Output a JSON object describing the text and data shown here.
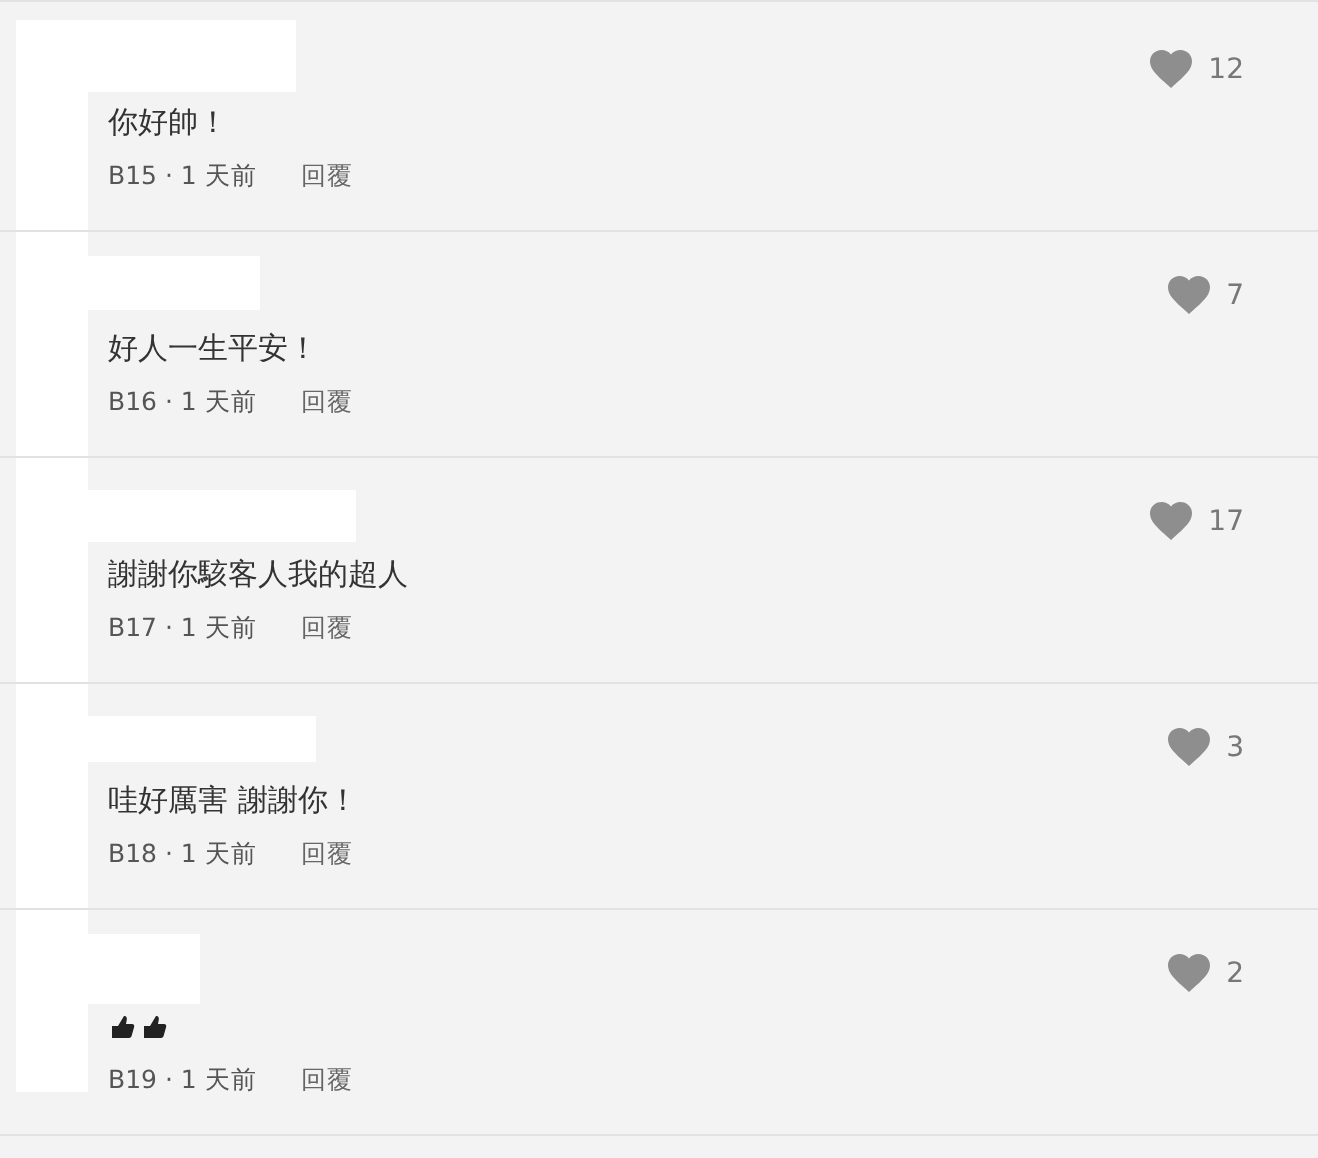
{
  "comments": [
    {
      "text": "你好帥！",
      "meta": "B15 · 1 天前",
      "reply": "回覆",
      "likes": "12"
    },
    {
      "text": "好人一生平安！",
      "meta": "B16 · 1 天前",
      "reply": "回覆",
      "likes": "7"
    },
    {
      "text": "謝謝你駭客人我的超人",
      "meta": "B17 · 1 天前",
      "reply": "回覆",
      "likes": "17"
    },
    {
      "text": "哇好厲害 謝謝你！",
      "meta": "B18 · 1 天前",
      "reply": "回覆",
      "likes": "3"
    },
    {
      "reactions": [
        {
          "kind": "thumbs-up"
        },
        {
          "kind": "thumbs-up"
        }
      ],
      "meta": "B19 · 1 天前",
      "reply": "回覆",
      "likes": "2"
    }
  ]
}
